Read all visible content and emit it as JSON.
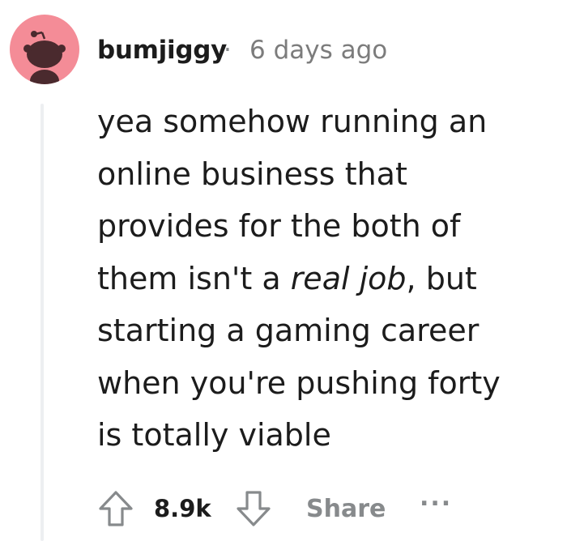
{
  "comment": {
    "author": "bumjiggy",
    "separator": "·",
    "age": "6 days ago",
    "body_line1": "yea somehow running an",
    "body_line2": "online business that",
    "body_line3": "provides for the both of",
    "body_line4_pre": "them isn't a ",
    "body_line4_em": "real job",
    "body_line4_post": ", but",
    "body_line5": "starting a gaming career",
    "body_line6": "when you're pushing forty",
    "body_line7": "is totally viable"
  },
  "actions": {
    "score": "8.9k",
    "share_label": "Share",
    "more_label": "..."
  },
  "icons": {
    "avatar": "reddit-snoo-avatar",
    "upvote": "arrow-up-icon",
    "downvote": "arrow-down-icon",
    "more": "ellipsis-icon"
  },
  "colors": {
    "avatar_bg": "#f48c97",
    "text": "#1c1c1c",
    "meta": "#7c7c7c",
    "muted": "#878a8c",
    "thread_line": "#edeff1"
  }
}
